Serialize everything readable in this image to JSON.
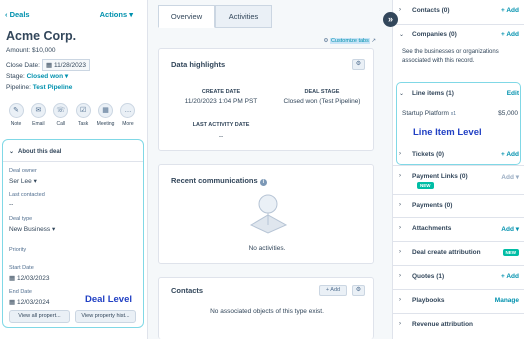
{
  "left": {
    "back_label": "Deals",
    "actions_label": "Actions",
    "record_name": "Acme Corp.",
    "amount_label": "Amount:",
    "amount_value": "$10,000",
    "close_date_label": "Close Date:",
    "close_date_value": "11/28/2023",
    "stage_label": "Stage:",
    "stage_value": "Closed won",
    "pipeline_label": "Pipeline:",
    "pipeline_value": "Test Pipeline",
    "activities": [
      {
        "label": "Note",
        "icon": "note-icon",
        "glyph": "✎"
      },
      {
        "label": "Email",
        "icon": "email-icon",
        "glyph": "✉"
      },
      {
        "label": "Call",
        "icon": "phone-icon",
        "glyph": "☏"
      },
      {
        "label": "Task",
        "icon": "task-icon",
        "glyph": "☑"
      },
      {
        "label": "Meeting",
        "icon": "calendar-icon",
        "glyph": "▦"
      },
      {
        "label": "More",
        "icon": "more-icon",
        "glyph": "…"
      }
    ]
  },
  "about": {
    "title": "About this deal",
    "owner_label": "Deal owner",
    "owner_value": "Ser Lee",
    "last_contacted_label": "Last contacted",
    "last_contacted_value": "--",
    "deal_type_label": "Deal type",
    "deal_type_value": "New Business",
    "priority_label": "Priority",
    "start_date_label": "Start Date",
    "start_date_value": "12/03/2023",
    "end_date_label": "End Date",
    "end_date_value": "12/03/2024",
    "annotation": "Deal Level",
    "view_all_label": "View all propert...",
    "view_history_label": "View property hist..."
  },
  "middle": {
    "tabs": [
      {
        "label": "Overview"
      },
      {
        "label": "Activities"
      }
    ],
    "customize_label": "Customize tabs",
    "highlights_title": "Data highlights",
    "create_date_label": "CREATE DATE",
    "create_date_value": "11/20/2023 1:04 PM PST",
    "deal_stage_label": "DEAL STAGE",
    "deal_stage_value": "Closed won (Test Pipeline)",
    "last_activity_label": "LAST ACTIVITY DATE",
    "last_activity_value": "--",
    "recent_comms_title": "Recent communications",
    "no_activities": "No activities.",
    "contacts_title": "Contacts",
    "contacts_add": "+ Add",
    "contacts_empty": "No associated objects of this type exist."
  },
  "right": {
    "contacts": {
      "label": "Contacts (0)",
      "add": "+ Add"
    },
    "companies": {
      "label": "Companies (0)",
      "add": "+ Add"
    },
    "companies_desc": "See the businesses or organizations associated with this record.",
    "line_items": {
      "label": "Line items (1)",
      "edit": "Edit"
    },
    "line_item_name": "Startup Platform",
    "line_item_qty": "x1",
    "line_item_price": "$5,000",
    "line_item_annotation": "Line Item Level",
    "tickets": {
      "label": "Tickets (0)",
      "add": "+ Add"
    },
    "payment_links": {
      "label": "Payment Links (0)",
      "badge": "NEW",
      "add": "Add"
    },
    "payments": {
      "label": "Payments (0)"
    },
    "attachments": {
      "label": "Attachments",
      "add": "Add"
    },
    "deal_create_attr": {
      "label": "Deal create attribution",
      "badge": "NEW"
    },
    "quotes": {
      "label": "Quotes (1)",
      "add": "+ Add"
    },
    "playbooks": {
      "label": "Playbooks",
      "add": "Manage"
    },
    "revenue_attr": {
      "label": "Revenue attribution"
    }
  },
  "colors": {
    "link": "#0091ae",
    "annotation": "#2140c4",
    "highlight_border": "#80d8e6",
    "new_badge": "#00bda5"
  }
}
